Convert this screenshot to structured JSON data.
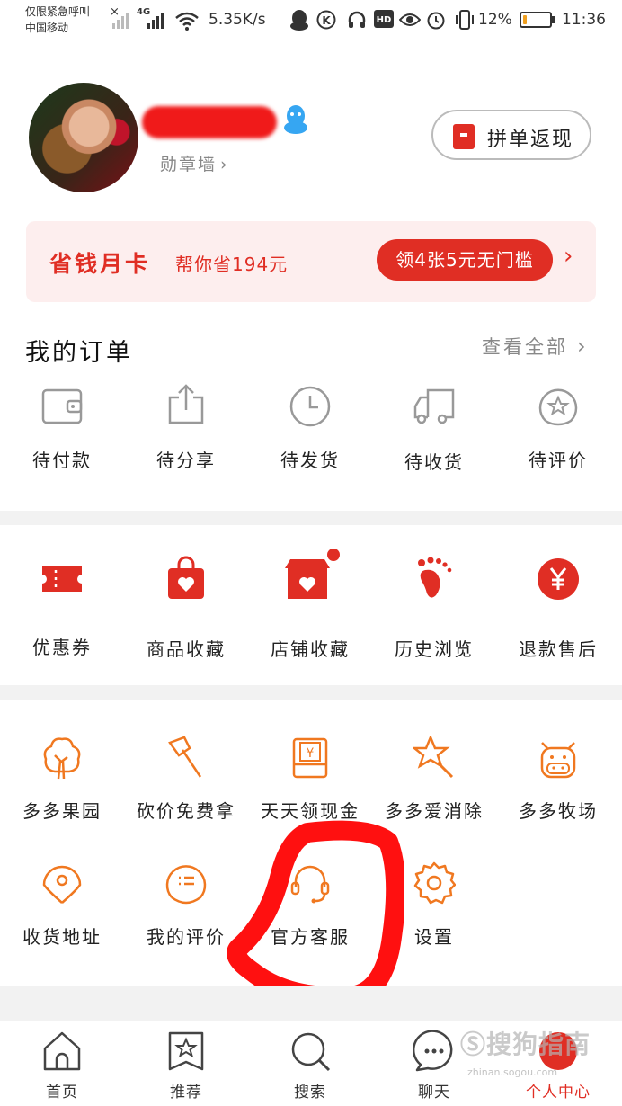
{
  "status_bar": {
    "carrier_line1": "仅限紧急呼叫",
    "carrier_line2": "中国移动",
    "network": "4G",
    "speed": "5.35K/s",
    "battery": "12%",
    "time": "11:36",
    "battery_level": 0.12
  },
  "profile": {
    "badge_wall": "勋章墙",
    "cashback_label": "拼单返现"
  },
  "money_card": {
    "title": "省钱月卡",
    "subtitle": "帮你省194元",
    "coupon_label": "领4张5元无门槛"
  },
  "orders": {
    "title": "我的订单",
    "see_all": "查看全部",
    "items": [
      {
        "label": "待付款",
        "icon": "wallet-icon"
      },
      {
        "label": "待分享",
        "icon": "share-icon"
      },
      {
        "label": "待发货",
        "icon": "clock-icon"
      },
      {
        "label": "待收货",
        "icon": "truck-icon"
      },
      {
        "label": "待评价",
        "icon": "review-star-icon"
      }
    ]
  },
  "services": {
    "items": [
      {
        "label": "优惠券",
        "icon": "coupon-icon"
      },
      {
        "label": "商品收藏",
        "icon": "bag-heart-icon"
      },
      {
        "label": "店铺收藏",
        "icon": "store-heart-icon"
      },
      {
        "label": "历史浏览",
        "icon": "footprint-icon"
      },
      {
        "label": "退款售后",
        "icon": "yuan-icon"
      }
    ]
  },
  "tools": {
    "row1": [
      {
        "label": "多多果园",
        "icon": "tree-icon"
      },
      {
        "label": "砍价免费拿",
        "icon": "axe-icon"
      },
      {
        "label": "天天领现金",
        "icon": "cash-envelope-icon"
      },
      {
        "label": "多多爱消除",
        "icon": "star-wand-icon"
      },
      {
        "label": "多多牧场",
        "icon": "cow-icon"
      }
    ],
    "row2": [
      {
        "label": "收货地址",
        "icon": "location-icon"
      },
      {
        "label": "我的评价",
        "icon": "comment-list-icon"
      },
      {
        "label": "官方客服",
        "icon": "headset-icon"
      },
      {
        "label": "设置",
        "icon": "settings-gear-icon"
      }
    ]
  },
  "bottom_nav": {
    "items": [
      {
        "label": "首页",
        "icon": "home-icon",
        "active": false
      },
      {
        "label": "推荐",
        "icon": "bookmark-star-icon",
        "active": false
      },
      {
        "label": "搜索",
        "icon": "search-icon",
        "active": false
      },
      {
        "label": "聊天",
        "icon": "chat-icon",
        "active": false
      },
      {
        "label": "个人中心",
        "icon": "profile-icon",
        "active": true
      }
    ]
  },
  "watermark": {
    "text": "Ⓢ搜狗指南",
    "sub": "zhinan.sogou.com"
  },
  "colors": {
    "brand_red": "#e02e24",
    "accent_orange": "#f07820",
    "divider": "#f2f2f2"
  }
}
